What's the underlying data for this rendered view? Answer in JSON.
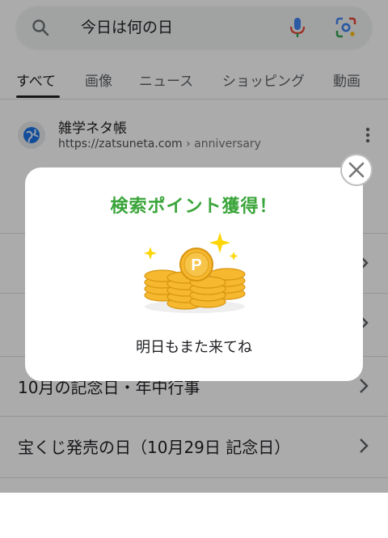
{
  "search": {
    "query": "今日は何の日"
  },
  "tabs": [
    {
      "label": "すべて"
    },
    {
      "label": "画像"
    },
    {
      "label": "ニュース"
    },
    {
      "label": "ショッピング"
    },
    {
      "label": "動画"
    }
  ],
  "result": {
    "site_name": "雑学ネタ帳",
    "url": "https://zatsuneta.com",
    "breadcrumb": " › anniversary"
  },
  "list": [
    {
      "label": "10月の記念日・年中行事"
    },
    {
      "label": "宝くじ発売の日（10月29日 記念日）"
    }
  ],
  "dialog": {
    "title": "検索ポイント獲得！",
    "coin_letter": "P",
    "message": "明日もまた来てね"
  },
  "colors": {
    "title_green": "#3aa53a",
    "coin_gold": "#f5b82e",
    "sparkle": "#ffd60a"
  }
}
